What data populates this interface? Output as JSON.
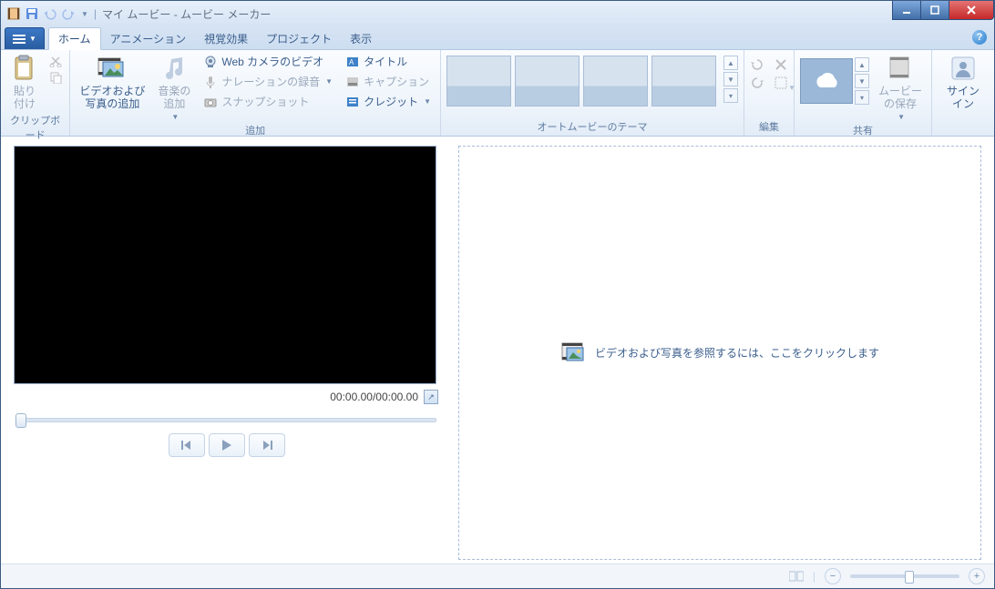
{
  "titlebar": {
    "title": "マイ ムービー - ムービー メーカー"
  },
  "tabs": {
    "home": "ホーム",
    "animation": "アニメーション",
    "visualEffects": "視覚効果",
    "project": "プロジェクト",
    "view": "表示"
  },
  "ribbon": {
    "clipboard": {
      "paste": "貼り\n付け",
      "label": "クリップボード"
    },
    "add": {
      "addVideosPhotos": "ビデオおよび\n写真の追加",
      "addMusic": "音楽の\n追加",
      "webcam": "Web カメラのビデオ",
      "narration": "ナレーションの録音",
      "snapshot": "スナップショット",
      "titleBtn": "タイトル",
      "caption": "キャプション",
      "credits": "クレジット",
      "label": "追加"
    },
    "themes": {
      "label": "オートムービーのテーマ"
    },
    "edit": {
      "label": "編集"
    },
    "share": {
      "saveMovie": "ムービー\nの保存",
      "label": "共有"
    },
    "signin": {
      "label": "サインイン"
    }
  },
  "preview": {
    "time": "00:00.00/00:00.00"
  },
  "dropZone": {
    "message": "ビデオおよび写真を参照するには、ここをクリックします"
  }
}
